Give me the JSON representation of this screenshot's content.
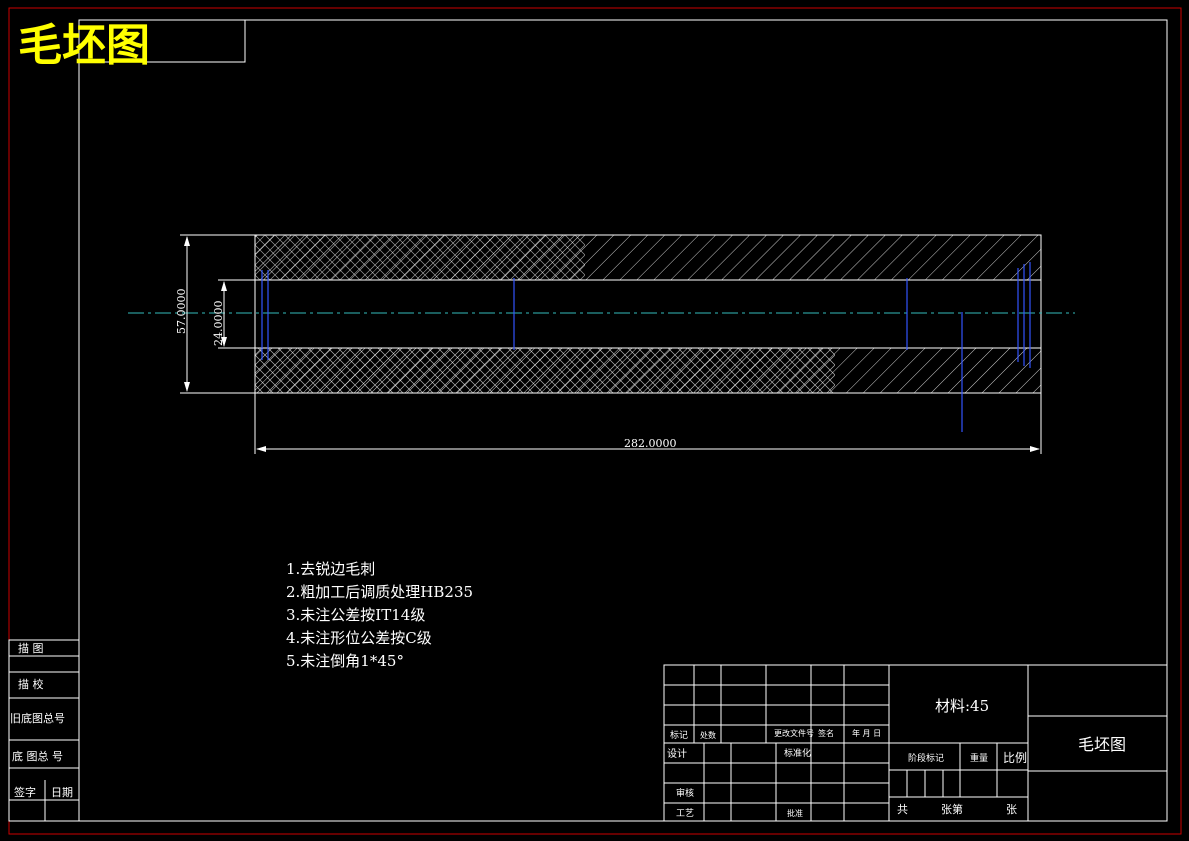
{
  "drawing_title": "毛坯图",
  "dimensions": {
    "outer_diameter": "57.0000",
    "inner_diameter": "24.0000",
    "length": "282.0000"
  },
  "technical_notes": [
    "1.去锐边毛刺",
    "2.粗加工后调质处理HB235",
    "3.未注公差按IT14级",
    "4.未注形位公差按C级",
    "5.未注倒角1*45°"
  ],
  "left_side_labels": {
    "trace": "描 图",
    "proof": "描 校",
    "old_drawing_number": "旧底图总号",
    "base_drawing_number": "底 图总 号",
    "signature": "签字",
    "date": "日期"
  },
  "title_block": {
    "material": "材料:45",
    "drawing_name": "毛坯图",
    "mark": "标记",
    "count": "处数",
    "change_doc": "更改文件号",
    "sign": "签名",
    "ymd": "年 月 日",
    "design": "设计",
    "standardize": "标准化",
    "review": "审核",
    "process": "工艺",
    "approve": "批准",
    "stage_mark": "阶段标记",
    "weight": "重量",
    "scale": "比例",
    "total": "共",
    "sheets": "张第",
    "sheet": "张"
  },
  "colors": {
    "frame_outer": "#cc0000",
    "frame_inner": "#ffffff",
    "hatch": "#ffffff",
    "centerline": "#33bbbb",
    "hidden_edges": "#3355ff",
    "title": "#ffff00"
  }
}
